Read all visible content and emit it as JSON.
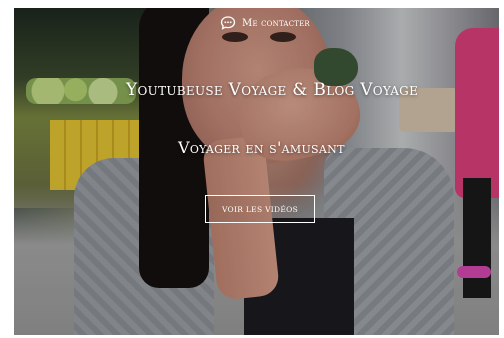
{
  "header": {
    "contact_label": "Me contacter",
    "contact_icon": "chat-bubble-icon"
  },
  "hero": {
    "title": "Youtubeuse Voyage & Blog Voyage",
    "subtitle": "Voyager en s'amusant",
    "cta_label": "VOIR LES VIDÉOS"
  },
  "colors": {
    "text": "#ffffff",
    "cta_border": "#ffffff"
  }
}
